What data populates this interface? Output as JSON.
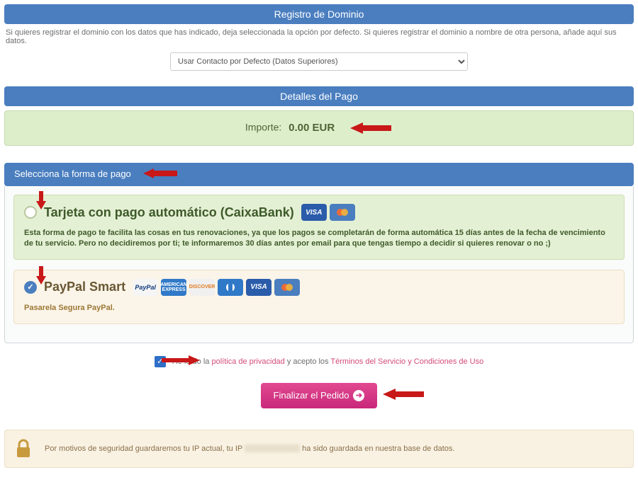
{
  "sections": {
    "domain_reg": {
      "title": "Registro de Dominio",
      "note": "Si quieres registrar el dominio con los datos que has indicado, deja seleccionada la opción por defecto. Si quieres registrar el dominio a nombre de otra persona, añade aquí sus datos.",
      "select_value": "Usar Contacto por Defecto (Datos Superiores)"
    },
    "payment_details": {
      "title": "Detalles del Pago",
      "label": "Importe:",
      "amount": "0.00 EUR"
    },
    "payment_method": {
      "title": "Selecciona la forma de pago",
      "options": [
        {
          "id": "caixa",
          "selected": false,
          "label": "Tarjeta con pago automático (CaixaBank)",
          "badges": [
            "VISA",
            "mastercard"
          ],
          "desc": "Esta forma de pago te facilita las cosas en tus renovaciones, ya que los pagos se completarán de forma automática 15 días antes de la fecha de vencimiento de tu servicio. Pero no decidiremos por ti; te informaremos 30 días antes por email para que tengas tiempo a decidir si quieres renovar o no ;)"
        },
        {
          "id": "paypal",
          "selected": true,
          "label": "PayPal Smart",
          "badges": [
            "PayPal",
            "AMEX",
            "DISCOVER",
            "Diners",
            "VISA",
            "mastercard"
          ],
          "desc": "Pasarela Segura PayPal."
        }
      ]
    }
  },
  "terms": {
    "pre": "He leído la ",
    "link1": "política de privacidad",
    "mid": " y acepto los ",
    "link2": "Términos del Servicio y Condiciones de Uso",
    "checked": true
  },
  "button": {
    "label": "Finalizar el Pedido"
  },
  "ip_notice": {
    "pre": "Por motivos de seguridad guardaremos tu IP actual, tu IP ",
    "post": " ha sido guardada en nuestra base de datos."
  }
}
